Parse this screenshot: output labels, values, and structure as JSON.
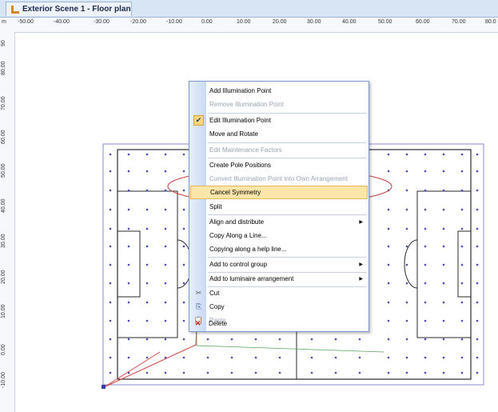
{
  "tab": {
    "title": "Exterior Scene 1 - Floor plan"
  },
  "ruler": {
    "unit": "m",
    "h_labels": [
      "-50.00",
      "-40.00",
      "-30.00",
      "-20.00",
      "-10.00",
      "0.00",
      "10.00",
      "20.00",
      "30.00",
      "40.00",
      "50.00",
      "60.00",
      "70.00",
      "80.0"
    ],
    "v_labels": [
      "90",
      "80.00",
      "70.00",
      "60.00",
      "50.00",
      "40.00",
      "30.00",
      "20.00",
      "10.00",
      "0.00",
      "-10.00"
    ]
  },
  "menu": {
    "items": [
      {
        "label": "Add Illumination Point",
        "disabled": false
      },
      {
        "label": "Remove Illumination Point",
        "disabled": true
      },
      {
        "label": "Edit Illumination Point",
        "disabled": false,
        "checked": true
      },
      {
        "label": "Move and Rotate",
        "disabled": false
      },
      {
        "label": "Edit Maintenance Factors",
        "disabled": true
      },
      {
        "label": "Create Pole Positions",
        "disabled": false
      },
      {
        "label": "Convert Illumination Point into Own Arrangement",
        "disabled": true
      },
      {
        "label": "Cancel Symmetry",
        "disabled": false,
        "highlighted": true
      },
      {
        "label": "Split",
        "disabled": false
      },
      {
        "label": "Align and distribute",
        "disabled": false,
        "submenu": true
      },
      {
        "label": "Copy Along a Line...",
        "disabled": false
      },
      {
        "label": "Copying along a help line...",
        "disabled": false
      },
      {
        "label": "Add to control group",
        "disabled": false,
        "submenu": true
      },
      {
        "label": "Add to luminaire arrangement",
        "disabled": false,
        "submenu": true
      },
      {
        "label": "Cut",
        "disabled": false,
        "icon": "scissors-icon"
      },
      {
        "label": "Copy",
        "disabled": false,
        "icon": "copy-icon"
      },
      {
        "label": "Paste",
        "disabled": true,
        "icon": "paste-icon"
      },
      {
        "label": "Delete",
        "disabled": false,
        "icon": "delete-x-icon"
      }
    ]
  },
  "colors": {
    "field_line": "#2a2a2a",
    "outer_boundary": "#8a8ad0",
    "points": "#4a4ab8",
    "highlight_ellipse": "#c04040",
    "menu_highlight": "#fbe5a8"
  }
}
